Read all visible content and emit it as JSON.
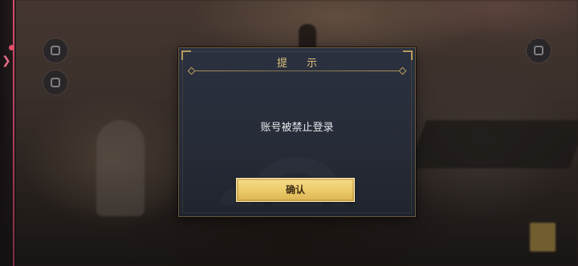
{
  "dialog": {
    "title": "提 示",
    "message": "账号被禁止登录",
    "confirm_label": "确认"
  },
  "colors": {
    "dialog_bg": "#2b3140",
    "gold_accent": "#e0c27a",
    "button_gold": "#eccc6c",
    "side_accent": "#e1506b"
  },
  "icons": {
    "side_arrow": "chevron-right-icon",
    "top_left_buttons": [
      "menu-icon",
      "menu-icon"
    ],
    "top_right_button": "menu-icon"
  }
}
